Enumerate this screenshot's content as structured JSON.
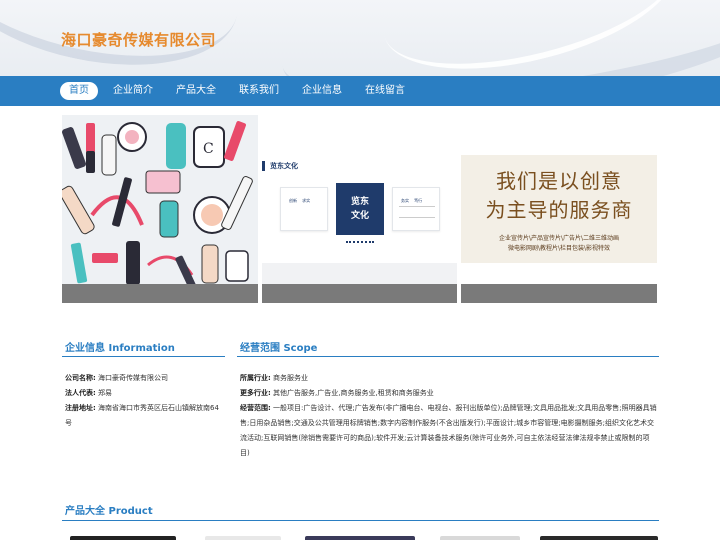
{
  "site": {
    "title": "海口豪奇传媒有限公司"
  },
  "nav": {
    "items": [
      {
        "label": "首页"
      },
      {
        "label": "企业简介"
      },
      {
        "label": "产品大全"
      },
      {
        "label": "联系我们"
      },
      {
        "label": "企业信息"
      },
      {
        "label": "在线留言"
      }
    ]
  },
  "banner": {
    "slide2": {
      "heading": "览东文化",
      "card1": "创新    求实",
      "card2_a": "览东",
      "card2_b": "文化",
      "card3": "务实    笃行"
    },
    "slide3": {
      "line1": "我们是以创意",
      "line2": "为主导的服务商",
      "sub1": "企业宣传片\\产品宣传片\\广告片\\二维三维动画",
      "sub2": "微电影网剧\\教程片\\栏目包装\\影视特效"
    }
  },
  "company_info": {
    "title_cn": "企业信息",
    "title_en": "Information",
    "name_label": "公司名称:",
    "name_value": "海口豪奇传媒有限公司",
    "rep_label": "法人代表:",
    "rep_value": "郑易",
    "addr_label": "注册地址:",
    "addr_value": "海南省海口市秀英区后石山镇解放南64号"
  },
  "business_scope": {
    "title_cn": "经营范围",
    "title_en": "Scope",
    "industry_label": "所属行业:",
    "industry_value": "商务服务业",
    "more_label": "更多行业:",
    "more_value": "其他广告服务,广告业,商务服务业,租赁和商务服务业",
    "scope_label": "经营范围:",
    "scope_value": "一般项目:广告设计、代理;广告发布(非广播电台、电视台、报刊出版单位);品牌管理;文具用品批发;文具用品零售;照明器具销售;日用杂品销售;交通及公共管理用标牌销售;数字内容制作服务(不含出版发行);平面设计;城乡市容管理;电影摄制服务;组织文化艺术交流活动;互联网销售(除销售需要许可的商品);软件开发;云计算装备技术服务(除许可业务外,可自主依法经营法律法规非禁止或限制的项目)"
  },
  "products": {
    "title_cn": "产品大全",
    "title_en": "Product"
  }
}
